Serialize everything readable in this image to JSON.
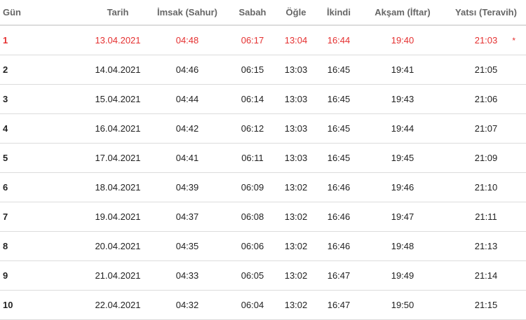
{
  "header": {
    "gun": "Gün",
    "tarih": "Tarih",
    "imsak": "İmsak (Sahur)",
    "sabah": "Sabah",
    "ogle": "Öğle",
    "ikindi": "İkindi",
    "aksam": "Akşam (İftar)",
    "yatsi": "Yatsı (Teravih)"
  },
  "today_marker": "*",
  "today_color": "#e53030",
  "rows": [
    {
      "gun": "1",
      "tarih": "13.04.2021",
      "imsak": "04:48",
      "sabah": "06:17",
      "ogle": "13:04",
      "ikindi": "16:44",
      "aksam": "19:40",
      "yatsi": "21:03"
    },
    {
      "gun": "2",
      "tarih": "14.04.2021",
      "imsak": "04:46",
      "sabah": "06:15",
      "ogle": "13:03",
      "ikindi": "16:45",
      "aksam": "19:41",
      "yatsi": "21:05"
    },
    {
      "gun": "3",
      "tarih": "15.04.2021",
      "imsak": "04:44",
      "sabah": "06:14",
      "ogle": "13:03",
      "ikindi": "16:45",
      "aksam": "19:43",
      "yatsi": "21:06"
    },
    {
      "gun": "4",
      "tarih": "16.04.2021",
      "imsak": "04:42",
      "sabah": "06:12",
      "ogle": "13:03",
      "ikindi": "16:45",
      "aksam": "19:44",
      "yatsi": "21:07"
    },
    {
      "gun": "5",
      "tarih": "17.04.2021",
      "imsak": "04:41",
      "sabah": "06:11",
      "ogle": "13:03",
      "ikindi": "16:45",
      "aksam": "19:45",
      "yatsi": "21:09"
    },
    {
      "gun": "6",
      "tarih": "18.04.2021",
      "imsak": "04:39",
      "sabah": "06:09",
      "ogle": "13:02",
      "ikindi": "16:46",
      "aksam": "19:46",
      "yatsi": "21:10"
    },
    {
      "gun": "7",
      "tarih": "19.04.2021",
      "imsak": "04:37",
      "sabah": "06:08",
      "ogle": "13:02",
      "ikindi": "16:46",
      "aksam": "19:47",
      "yatsi": "21:11"
    },
    {
      "gun": "8",
      "tarih": "20.04.2021",
      "imsak": "04:35",
      "sabah": "06:06",
      "ogle": "13:02",
      "ikindi": "16:46",
      "aksam": "19:48",
      "yatsi": "21:13"
    },
    {
      "gun": "9",
      "tarih": "21.04.2021",
      "imsak": "04:33",
      "sabah": "06:05",
      "ogle": "13:02",
      "ikindi": "16:47",
      "aksam": "19:49",
      "yatsi": "21:14"
    },
    {
      "gun": "10",
      "tarih": "22.04.2021",
      "imsak": "04:32",
      "sabah": "06:04",
      "ogle": "13:02",
      "ikindi": "16:47",
      "aksam": "19:50",
      "yatsi": "21:15"
    }
  ]
}
